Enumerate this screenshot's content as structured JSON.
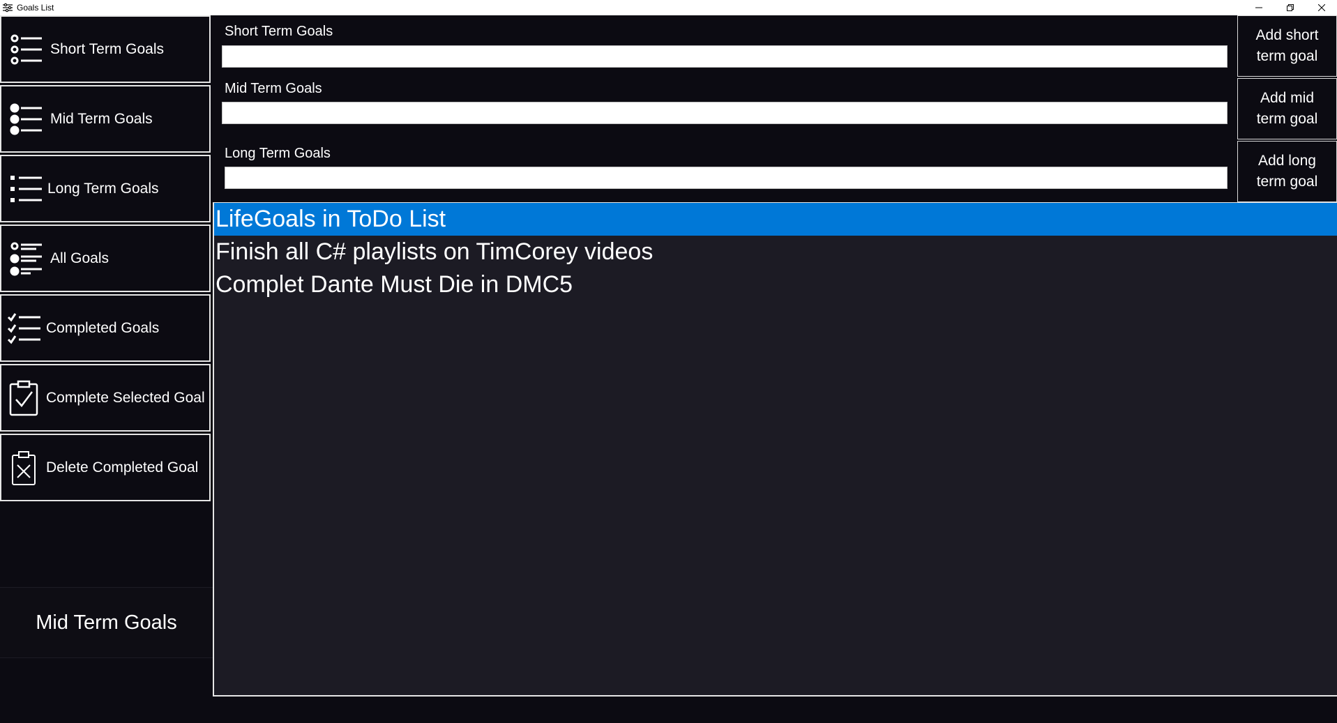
{
  "window": {
    "title": "Goals List",
    "app_icon": "settings-sliders-icon",
    "controls": {
      "minimize_icon": "minimize-icon",
      "restore_icon": "restore-icon",
      "close_icon": "close-icon"
    }
  },
  "sidebar": {
    "items": [
      {
        "label": "Short Term Goals",
        "icon": "list-hollow-bullets-icon"
      },
      {
        "label": "Mid Term Goals",
        "icon": "list-filled-bullets-icon"
      },
      {
        "label": "Long Term Goals",
        "icon": "bulleted-list-icon"
      },
      {
        "label": "All Goals",
        "icon": "mixed-bullet-list-icon"
      },
      {
        "label": "Completed Goals",
        "icon": "checklist-icon"
      },
      {
        "label": "Complete Selected Goal",
        "icon": "clipboard-check-icon"
      },
      {
        "label": "Delete Completed Goal",
        "icon": "clipboard-x-icon"
      }
    ],
    "current_view": "Mid Term Goals"
  },
  "inputs": {
    "short": {
      "label": "Short Term Goals",
      "value": "",
      "placeholder": ""
    },
    "mid": {
      "label": "Mid Term Goals",
      "value": "",
      "placeholder": ""
    },
    "long": {
      "label": "Long Term Goals",
      "value": "",
      "placeholder": ""
    }
  },
  "add_buttons": {
    "short": "Add short term goal",
    "mid": "Add mid term goal",
    "long": "Add long term goal"
  },
  "goals": {
    "selected_index": 0,
    "items": [
      "LifeGoals in ToDo List",
      "Finish all C# playlists on TimCorey videos",
      "Complet Dante Must Die in DMC5"
    ]
  },
  "colors": {
    "background": "#0c0b12",
    "list_background": "#1c1b24",
    "selection": "#0078d7",
    "border": "#e6e6e6"
  }
}
